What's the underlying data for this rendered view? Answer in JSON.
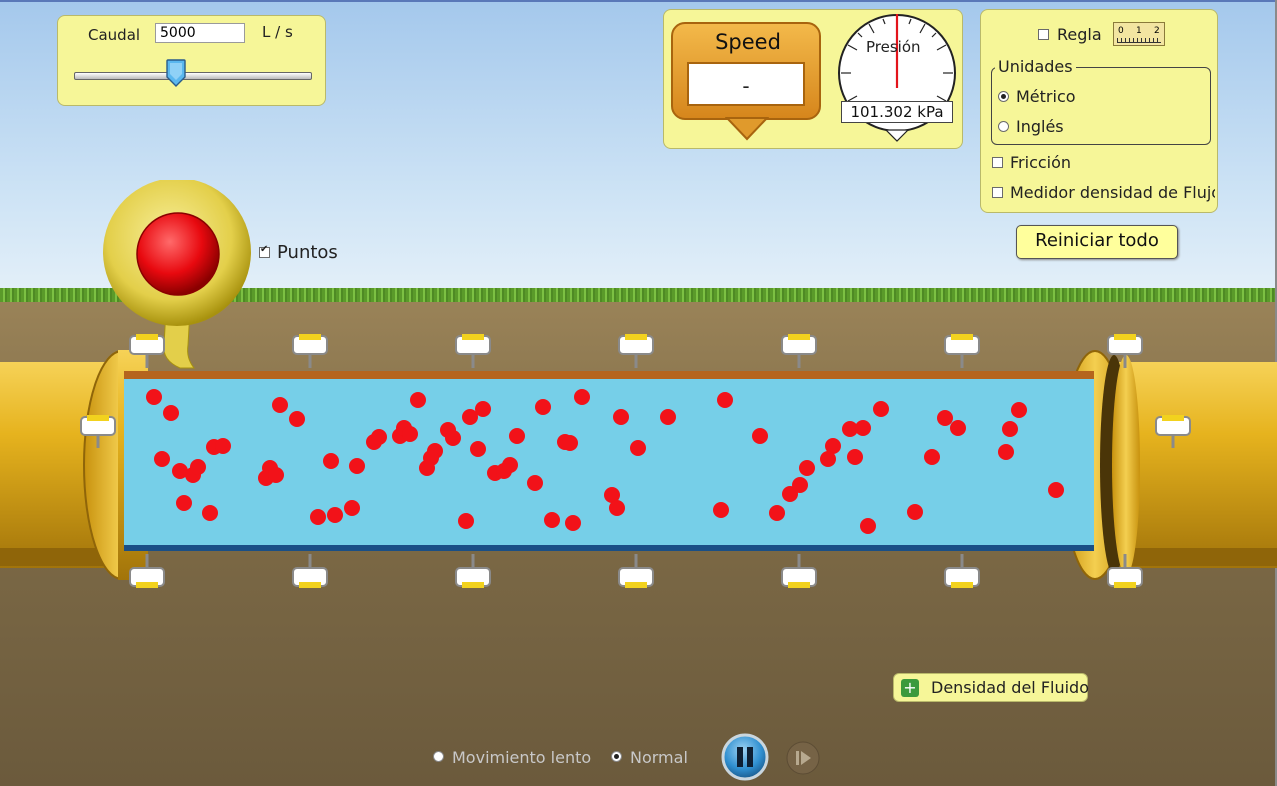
{
  "flow_panel": {
    "label": "Caudal",
    "value": "5000",
    "unit": "L / s",
    "slider_fraction": 0.5
  },
  "speed_sign": {
    "title": "Speed",
    "value": "-"
  },
  "pressure_gauge": {
    "label": "Presión",
    "reading": "101.302 kPa"
  },
  "units_panel": {
    "ruler_label": "Regla",
    "ruler_ticks": [
      "0",
      "1",
      "2"
    ],
    "units_title": "Unidades",
    "metric_label": "Métrico",
    "english_label": "Inglés",
    "friction_label": "Fricción",
    "flux_meter_label": "Medidor densidad de Flujo"
  },
  "reset_button": {
    "label": "Reiniciar todo"
  },
  "dots_checkbox": {
    "label": "Puntos",
    "checked": true
  },
  "density_button": {
    "label": "Densidad del Fluido"
  },
  "playback": {
    "slow_label": "Movimiento lento",
    "normal_label": "Normal"
  },
  "colors": {
    "panel": "#f6f698",
    "pipe": "#e6b31e",
    "water": "#76cfe8",
    "particle": "#f21219",
    "speed_sign": "#e89f30"
  },
  "icons": [
    "slider-thumb-icon",
    "ruler-icon",
    "pause-icon",
    "step-icon",
    "plus-icon",
    "grab-handle-icon"
  ]
}
